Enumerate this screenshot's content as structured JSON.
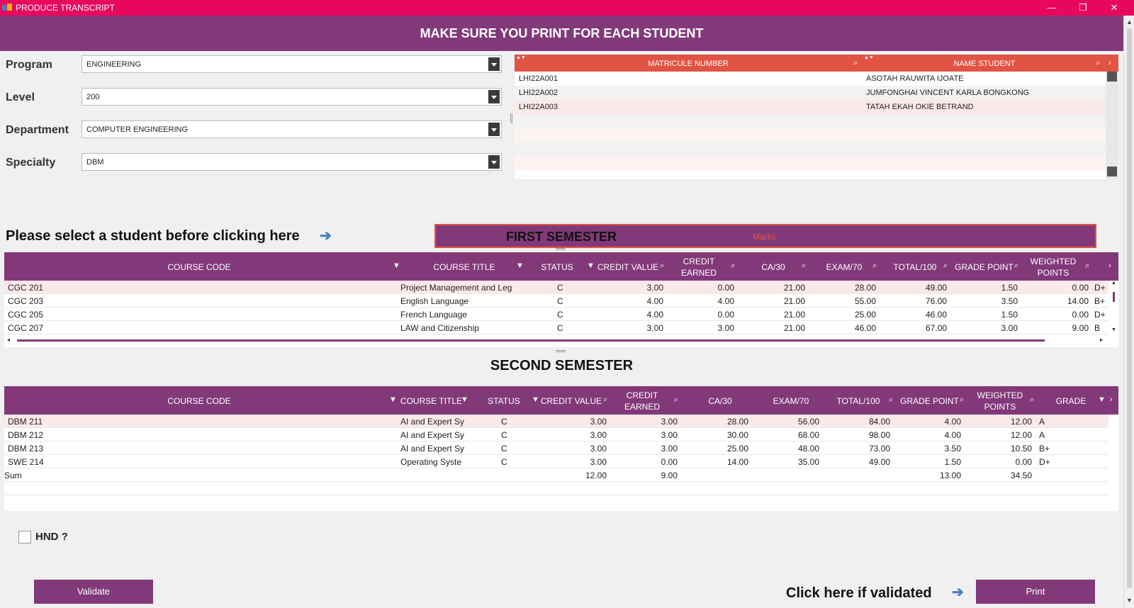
{
  "window": {
    "title": "PRODUCE TRANSCRIPT",
    "minimize": "—",
    "restore": "❐",
    "close": "✕"
  },
  "header": {
    "title": "MAKE SURE YOU PRINT FOR EACH STUDENT"
  },
  "form": {
    "program": {
      "label": "Program",
      "value": "ENGINEERING"
    },
    "level": {
      "label": "Level",
      "value": "200"
    },
    "department": {
      "label": "Department",
      "value": "COMPUTER ENGINEERING"
    },
    "specialty": {
      "label": "Specialty",
      "value": "DBM"
    }
  },
  "students": {
    "columns": [
      "MATRICULE NUMBER",
      "NAME STUDENT"
    ],
    "rows": [
      {
        "matricule": "LHI22A001",
        "name": "ASOTAH RAUWITA IJOATE"
      },
      {
        "matricule": "LHI22A002",
        "name": "JUMFONGHAI VINCENT KARLA BONGKONG"
      },
      {
        "matricule": "LHI22A003",
        "name": "TATAH EKAH OKIE BETRAND"
      }
    ]
  },
  "prompt": {
    "text": "Please select a student before clicking here",
    "arrow": "➔"
  },
  "first_semester": {
    "title": "FIRST SEMESTER",
    "marks_label": "Marks",
    "columns": [
      "COURSE CODE",
      "COURSE TITLE",
      "STATUS",
      "CREDIT VALUE",
      "CREDIT",
      "EARNED",
      "CA/30",
      "EXAM/70",
      "TOTAL/100",
      "GRADE POINT",
      "WEIGHTED",
      "POINTS"
    ],
    "rows": [
      {
        "code": "CGC 201",
        "title": "Project Management and Leg",
        "status": "C",
        "credit_value": "3.00",
        "credit_earned": "0.00",
        "ca": "21.00",
        "exam": "28.00",
        "total": "49.00",
        "grade_point": "1.50",
        "weighted": "0.00",
        "grade": "D+"
      },
      {
        "code": "CGC 203",
        "title": "English Language",
        "status": "C",
        "credit_value": "4.00",
        "credit_earned": "4.00",
        "ca": "21.00",
        "exam": "55.00",
        "total": "76.00",
        "grade_point": "3.50",
        "weighted": "14.00",
        "grade": "B+"
      },
      {
        "code": "CGC 205",
        "title": "French Language",
        "status": "C",
        "credit_value": "4.00",
        "credit_earned": "0.00",
        "ca": "21.00",
        "exam": "25.00",
        "total": "46.00",
        "grade_point": "1.50",
        "weighted": "0.00",
        "grade": "D+"
      },
      {
        "code": "CGC 207",
        "title": "LAW and Citizenship",
        "status": "C",
        "credit_value": "3.00",
        "credit_earned": "3.00",
        "ca": "21.00",
        "exam": "46.00",
        "total": "67.00",
        "grade_point": "3.00",
        "weighted": "9.00",
        "grade": "B"
      }
    ]
  },
  "second_semester": {
    "title": "SECOND SEMESTER",
    "columns": [
      "COURSE CODE",
      "COURSE TITLE",
      "STATUS",
      "CREDIT VALUE",
      "CREDIT",
      "EARNED",
      "CA/30",
      "EXAM/70",
      "TOTAL/100",
      "GRADE POINT",
      "WEIGHTED",
      "POINTS",
      "GRADE"
    ],
    "rows": [
      {
        "code": "DBM 211",
        "title": "AI and Expert Sy",
        "status": "C",
        "credit_value": "3.00",
        "credit_earned": "3.00",
        "ca": "28.00",
        "exam": "56.00",
        "total": "84.00",
        "grade_point": "4.00",
        "weighted": "12.00",
        "grade": "A"
      },
      {
        "code": "DBM 212",
        "title": "AI and Expert Sy",
        "status": "C",
        "credit_value": "3.00",
        "credit_earned": "3.00",
        "ca": "30.00",
        "exam": "68.00",
        "total": "98.00",
        "grade_point": "4.00",
        "weighted": "12.00",
        "grade": "A"
      },
      {
        "code": "DBM 213",
        "title": "AI and Expert Sy",
        "status": "C",
        "credit_value": "3.00",
        "credit_earned": "3.00",
        "ca": "25.00",
        "exam": "48.00",
        "total": "73.00",
        "grade_point": "3.50",
        "weighted": "10.50",
        "grade": "B+"
      },
      {
        "code": "SWE 214",
        "title": "Operating Syste",
        "status": "C",
        "credit_value": "3.00",
        "credit_earned": "0.00",
        "ca": "14.00",
        "exam": "35.00",
        "total": "49.00",
        "grade_point": "1.50",
        "weighted": "0.00",
        "grade": "D+"
      }
    ],
    "sum": {
      "label": "Sum",
      "credit_value": "12.00",
      "credit_earned": "9.00",
      "grade_point": "13.00",
      "weighted": "34.50"
    }
  },
  "hnd": {
    "label": "HND ?",
    "checked": false
  },
  "actions": {
    "validate": "Validate",
    "click_label": "Click here if validated",
    "arrow": "➔",
    "print": "Print"
  },
  "colors": {
    "titlebar": "#e8075f",
    "purple": "#823979",
    "red_header": "#e15444",
    "highlight": "#fbe9ea",
    "arrow": "#4a7fc1"
  }
}
